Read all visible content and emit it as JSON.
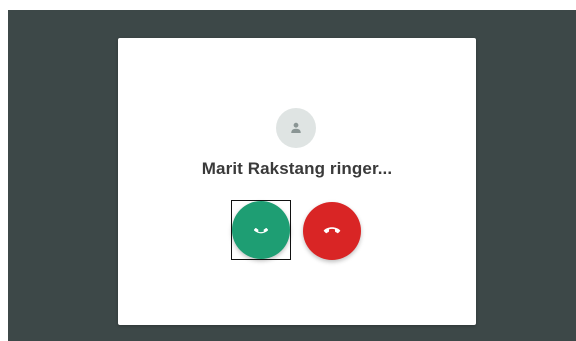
{
  "call": {
    "caller_text": "Marit Rakstang ringer...",
    "accept_icon": "phone-answer-icon",
    "decline_icon": "phone-hangup-icon",
    "avatar_icon": "person-icon"
  },
  "colors": {
    "backdrop": "#3d4848",
    "accept": "#1e9e73",
    "decline": "#d92525",
    "avatar_bg": "#dfe4e3"
  }
}
